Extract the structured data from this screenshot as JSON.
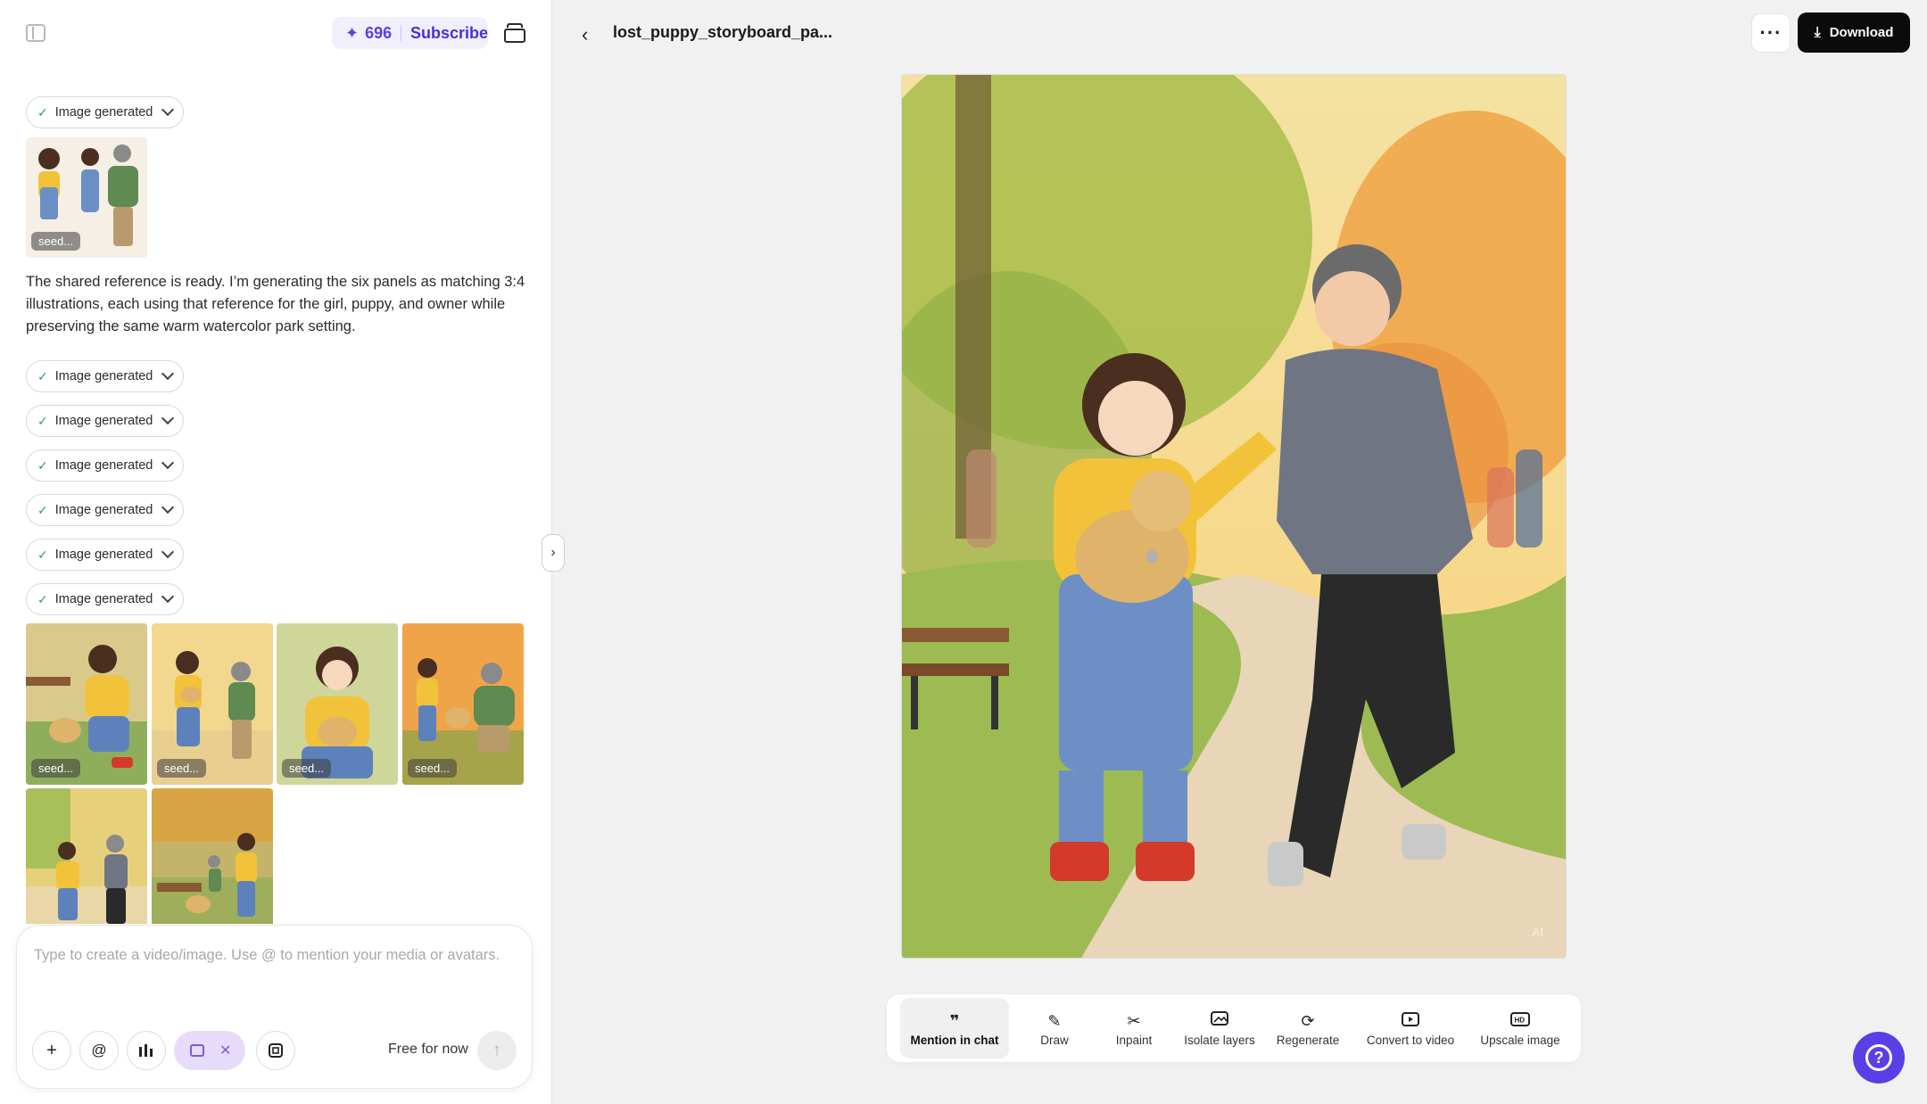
{
  "header": {
    "credits": "696",
    "subscribe_label": "Subscribe"
  },
  "chat": {
    "status_chip_label": "Image generated",
    "reference_seed_label": "seed...",
    "message": "The shared reference is ready. I’m generating the six panels as matching 3:4 illustrations, each using that reference for the girl, puppy, and owner while preserving the same warm watercolor park setting.",
    "seed_label": "seed..."
  },
  "composer": {
    "placeholder": "Type to create a video/image. Use @ to mention your media or avatars.",
    "add_icon": "plus-icon",
    "mention_icon": "at-icon",
    "chart_icon": "bar-chart-icon",
    "image_mode_icon": "image-icon",
    "aspect_icon": "aspect-ratio-icon",
    "price_label": "Free for now"
  },
  "viewer": {
    "file_name": "lost_puppy_storyboard_pa...",
    "more_label": "···",
    "download_label": "Download",
    "watermark": "AI"
  },
  "toolbar": {
    "tools": [
      {
        "label": "Mention in chat",
        "icon": "quote-icon"
      },
      {
        "label": "Draw",
        "icon": "brush-icon"
      },
      {
        "label": "Inpaint",
        "icon": "scissors-icon"
      },
      {
        "label": "Isolate layers",
        "icon": "layers-icon"
      },
      {
        "label": "Regenerate",
        "icon": "refresh-icon"
      },
      {
        "label": "Convert to video",
        "icon": "play-icon"
      },
      {
        "label": "Upscale image",
        "icon": "hd-icon"
      }
    ]
  },
  "colors": {
    "accent": "#5a3ee6",
    "accent_light": "#e6dcfa",
    "primary_button": "#0b0b0b",
    "success_check": "#22a06b"
  }
}
